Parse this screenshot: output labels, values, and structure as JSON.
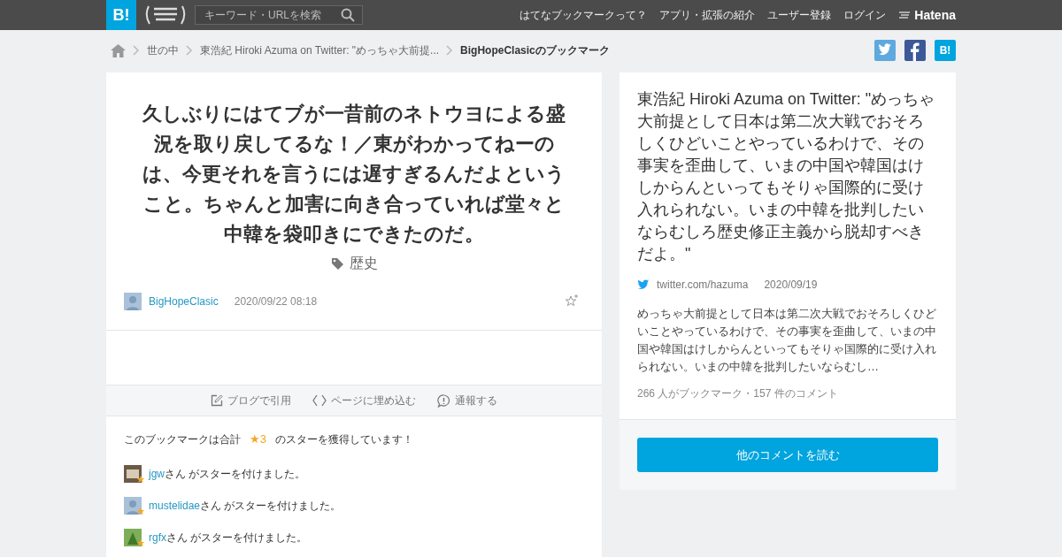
{
  "header": {
    "logo": "B!",
    "search": {
      "placeholder": "キーワード・URLを検索"
    },
    "nav": [
      "はてなブックマークって？",
      "アプリ・拡張の紹介",
      "ユーザー登録",
      "ログイン"
    ],
    "brand": "Hatena"
  },
  "breadcrumb": [
    "世の中",
    "東浩紀 Hiroki Azuma on Twitter: \"めっちゃ大前提...",
    "BigHopeClasicのブックマーク"
  ],
  "share": {
    "bookmark_label": "B!"
  },
  "bookmark": {
    "comment": "久しぶりにはてブが一昔前のネトウヨによる盛況を取り戻してるな！／東がわかってねーのは、今更それを言うには遅すぎるんだよということ。ちゃんと加害に向き合っていれば堂々と中韓を袋叩きにできたのだ。",
    "tag": "歴史",
    "user": "BigHopeClasic",
    "time": "2020/09/22 08:18",
    "actions": [
      {
        "kind": "blog",
        "label": "ブログで引用"
      },
      {
        "kind": "embed",
        "label": "ページに埋め込む"
      },
      {
        "kind": "report",
        "label": "通報する"
      }
    ],
    "stars_text_before": "このブックマークは合計",
    "star_count": "★3",
    "stars_text_after": "のスターを獲得しています！",
    "stargivers": [
      {
        "user": "jgw",
        "text": "さん がスターを付けました。",
        "kind": "photo"
      },
      {
        "user": "mustelidae",
        "text": "さん がスターを付けました。",
        "kind": "default"
      },
      {
        "user": "rgfx",
        "text": "さん がスターを付けました。",
        "kind": "plant"
      }
    ]
  },
  "entry": {
    "title": "東浩紀 Hiroki Azuma on Twitter: \"めっちゃ大前提として日本は第二次大戦でおそろしくひどいことやっているわけで、その事実を歪曲して、いまの中国や韓国はけしからんといってもそりゃ国際的に受け入れられない。いまの中韓を批判したいならむしろ歴史修正主義から脱却すべきだよ。\"",
    "domain": "twitter.com/hazuma",
    "date": "2020/09/19",
    "summary": "めっちゃ大前提として日本は第二次大戦でおそろしくひどいことやっているわけで、その事実を歪曲して、いまの中国や韓国はけしからんといってもそりゃ国際的に受け入れられない。いまの中韓を批判したいならむし…",
    "counts": "266 人がブックマーク・157 件のコメント",
    "more_button": "他のコメントを読む"
  }
}
